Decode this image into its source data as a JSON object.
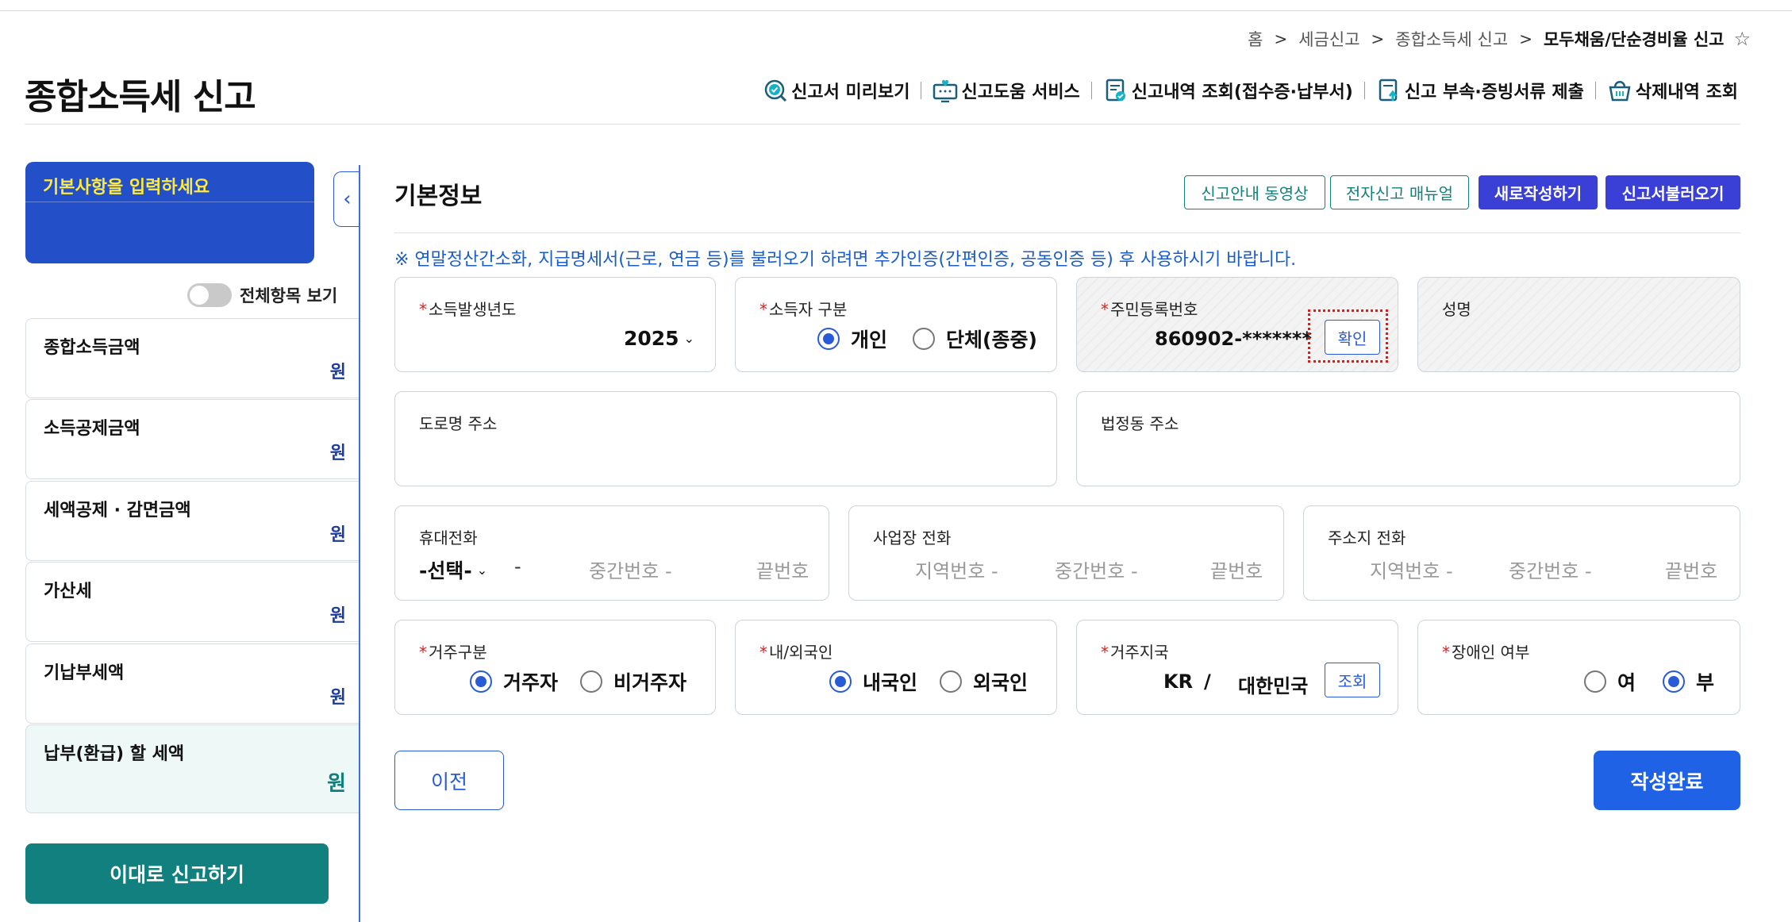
{
  "breadcrumb": [
    "홈",
    "세금신고",
    "종합소득세 신고",
    "모두채움/단순경비율 신고"
  ],
  "breadcrumb_sep": ">",
  "page_title": "종합소득세 신고",
  "top_links": [
    {
      "label": "신고서 미리보기",
      "icon": "check-search-icon"
    },
    {
      "label": "신고도움 서비스",
      "icon": "monitor-heart-icon"
    },
    {
      "label": "신고내역 조회(접수증·납부서)",
      "icon": "document-check-icon"
    },
    {
      "label": "신고 부속·증빙서류 제출",
      "icon": "document-upload-icon"
    },
    {
      "label": "삭제내역 조회",
      "icon": "basket-icon"
    }
  ],
  "sidebar": {
    "info_title": "기본사항을 입력하세요",
    "toggle_label": "전체항목 보기",
    "items": [
      {
        "label": "종합소득금액",
        "unit": "원"
      },
      {
        "label": "소득공제금액",
        "unit": "원"
      },
      {
        "label": "세액공제 · 감면금액",
        "unit": "원"
      },
      {
        "label": "가산세",
        "unit": "원"
      },
      {
        "label": "기납부세액",
        "unit": "원"
      },
      {
        "label": "납부(환급) 할 세액",
        "unit": "원"
      }
    ],
    "file_button": "이대로 신고하기"
  },
  "main": {
    "section_title": "기본정보",
    "buttons": [
      "신고안내 동영상",
      "전자신고 매뉴얼",
      "새로작성하기",
      "신고서불러오기"
    ],
    "notice": "※ 연말정산간소화, 지급명세서(근로, 연금 등)를 불러오기 하려면 추가인증(간편인증, 공동인증 등) 후 사용하시기 바랍니다.",
    "req_mark": "*",
    "year": {
      "label": "소득발생년도",
      "value": "2025"
    },
    "filer_type": {
      "label": "소득자 구분",
      "options": [
        "개인",
        "단체(종중)"
      ],
      "selected": "개인"
    },
    "resident_no": {
      "label": "주민등록번호",
      "value": "860902-*******",
      "button": "확인"
    },
    "name": {
      "label": "성명",
      "value": ""
    },
    "road_address": {
      "label": "도로명 주소"
    },
    "lot_address": {
      "label": "법정동 주소"
    },
    "mobile": {
      "label": "휴대전화",
      "select": "-선택-",
      "dash": "-",
      "middle": "중간번호 -",
      "last": "끝번호"
    },
    "biz_phone": {
      "label": "사업장 전화",
      "area": "지역번호 -",
      "middle": "중간번호 -",
      "last": "끝번호"
    },
    "home_phone": {
      "label": "주소지 전화",
      "area": "지역번호 -",
      "middle": "중간번호 -",
      "last": "끝번호"
    },
    "residency": {
      "label": "거주구분",
      "options": [
        "거주자",
        "비거주자"
      ],
      "selected": "거주자"
    },
    "nationality": {
      "label": "내/외국인",
      "options": [
        "내국인",
        "외국인"
      ],
      "selected": "내국인"
    },
    "country": {
      "label": "거주지국",
      "code": "KR",
      "slash": "/",
      "name": "대한민국",
      "button": "조회"
    },
    "disabled": {
      "label": "장애인 여부",
      "options": [
        "여",
        "부"
      ],
      "selected": "부"
    },
    "prev_button": "이전",
    "done_button": "작성완료"
  },
  "colors": {
    "primary": "#1f62e6",
    "teal": "#11807e",
    "sidebar_box": "#2350c8",
    "indigo": "#3a3fd6",
    "required": "#e02020"
  }
}
